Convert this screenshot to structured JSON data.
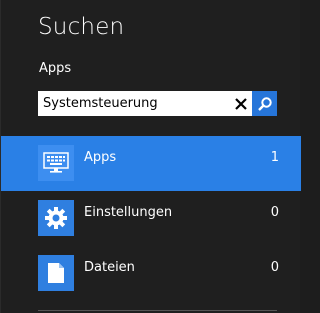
{
  "charm": {
    "title": "Suchen",
    "scope": "Apps"
  },
  "search": {
    "value": "Systemsteuerung",
    "clear_icon": "close-icon",
    "submit_icon": "search-icon"
  },
  "results": [
    {
      "label": "Apps",
      "count": "1",
      "icon": "monitor-keyboard-icon",
      "selected": true
    },
    {
      "label": "Einstellungen",
      "count": "0",
      "icon": "gear-icon",
      "selected": false
    },
    {
      "label": "Dateien",
      "count": "0",
      "icon": "document-icon",
      "selected": false
    }
  ],
  "colors": {
    "background": "#1f1f1f",
    "accent": "#2a80e6",
    "tile": "#2f7fe0"
  }
}
